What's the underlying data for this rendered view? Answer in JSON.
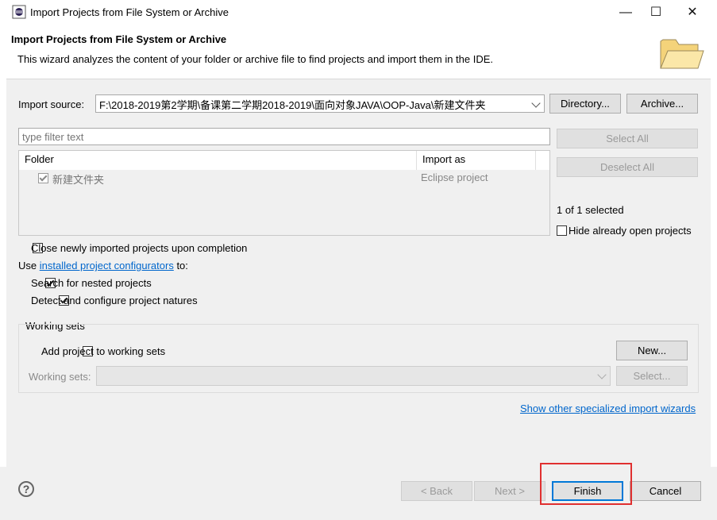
{
  "window": {
    "title": "Import Projects from File System or Archive",
    "minimize_glyph": "—",
    "maximize_glyph": "☐",
    "close_glyph": "✕"
  },
  "header": {
    "title": "Import Projects from File System or Archive",
    "description": "This wizard analyzes the content of your folder or archive file to find projects and import them in the IDE."
  },
  "import_source": {
    "label": "Import source:",
    "value": "F:\\2018-2019第2学期\\备课第二学期2018-2019\\面向对象JAVA\\OOP-Java\\新建文件夹",
    "directory_button": "Directory...",
    "archive_button": "Archive..."
  },
  "filter": {
    "placeholder": "type filter text"
  },
  "table": {
    "columns": [
      "Folder",
      "Import as"
    ],
    "rows": [
      {
        "folder": "新建文件夹",
        "import_as": "Eclipse project",
        "checked": true
      }
    ]
  },
  "side_buttons": {
    "select_all": "Select All",
    "deselect_all": "Deselect All",
    "selected_count": "1 of 1 selected",
    "hide_open_projects": "Hide already open projects"
  },
  "options": {
    "close_imported": "Close newly imported projects upon completion",
    "use_prefix": "Use ",
    "configurators_link": "installed project configurators",
    "use_suffix": " to:",
    "search_nested": "Search for nested projects",
    "detect_natures": "Detect and configure project natures"
  },
  "working_sets": {
    "group_label": "Working sets",
    "add_checkbox": "Add project to working sets",
    "new_button": "New...",
    "sets_label": "Working sets:",
    "select_button": "Select..."
  },
  "other_wizards_link": "Show other specialized import wizards",
  "footer": {
    "help_glyph": "?",
    "back_button": "< Back",
    "next_button": "Next >",
    "finish_button": "Finish",
    "cancel_button": "Cancel"
  },
  "colors": {
    "highlight": "#e03030",
    "link": "#0066cc",
    "finish_border": "#0078d7"
  }
}
